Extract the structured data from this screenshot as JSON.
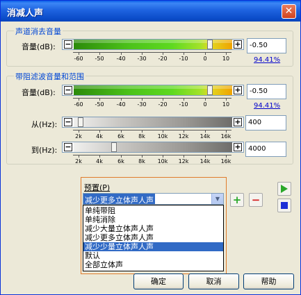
{
  "window": {
    "title": "消减人声",
    "close_glyph": "✕"
  },
  "section1": {
    "title": "声道消去音量",
    "volume_label": "音量(dB):",
    "value": "-0.50",
    "percent": "94.41%",
    "scale": [
      "-60",
      "-50",
      "-40",
      "-30",
      "-20",
      "-10",
      "0",
      "10"
    ],
    "level_fraction": 0.86
  },
  "section2": {
    "title": "带阻滤波音量和范围",
    "volume_label": "音量(dB):",
    "value": "-0.50",
    "percent": "94.41%",
    "scale": [
      "-60",
      "-50",
      "-40",
      "-30",
      "-20",
      "-10",
      "0",
      "10"
    ],
    "level_fraction": 0.86,
    "from_label": "从(Hz):",
    "from_value": "400",
    "to_label": "到(Hz):",
    "to_value": "4000",
    "hz_scale": [
      "2k",
      "4k",
      "6k",
      "8k",
      "10k",
      "12k",
      "14k",
      "16k"
    ]
  },
  "preset": {
    "label": "预置(P)",
    "selected": "减少更多立体声人声",
    "options": [
      "单纯带阻",
      "单纯消除",
      "减少大量立体声人声",
      "减少更多立体声人声",
      "减少少量立体声人声",
      "默认",
      "全部立体声"
    ],
    "highlighted_index": 4,
    "add_glyph": "+",
    "remove_glyph": "−"
  },
  "buttons": {
    "ok": "确定",
    "cancel": "取消",
    "help": "帮助"
  },
  "colors": {
    "title_bar": "#0a5fe8",
    "accent_text": "#0046d5",
    "selection": "#316ac5",
    "preset_border": "#e07b2a",
    "play_green": "#2aa82a",
    "stop_blue": "#1c2fd6"
  }
}
